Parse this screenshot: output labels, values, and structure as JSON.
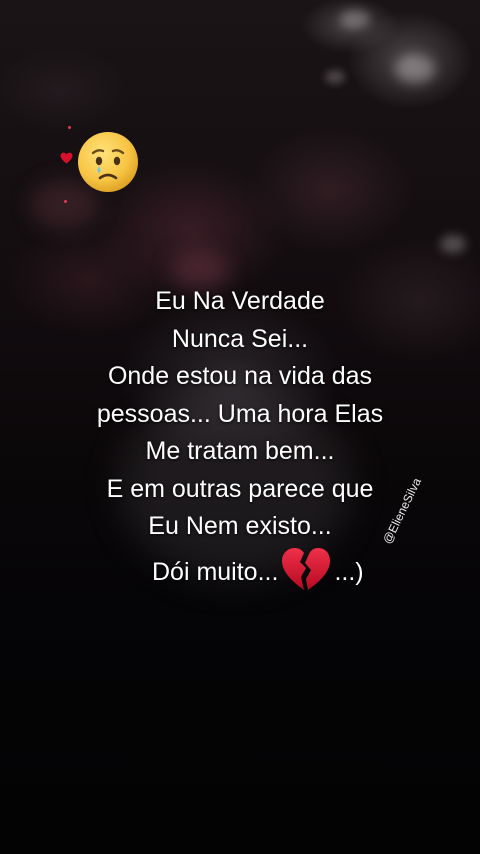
{
  "quote": {
    "lines": [
      "Eu Na Verdade",
      "Nunca Sei...",
      "Onde estou na vida das",
      "pessoas... Uma hora Elas",
      "Me tratam bem...",
      "E em outras parece que",
      "Eu Nem existo..."
    ],
    "last_line_before": "Dói muito...",
    "last_line_after": "...)"
  },
  "watermark": "@ElieneSilva",
  "icons": {
    "sad_face": "worried-face-icon",
    "small_heart": "heart-icon",
    "broken_heart": "broken-heart-icon"
  },
  "colors": {
    "text": "#ffffff",
    "heart_red": "#d8102e",
    "face_yellow": "#f7c443"
  }
}
